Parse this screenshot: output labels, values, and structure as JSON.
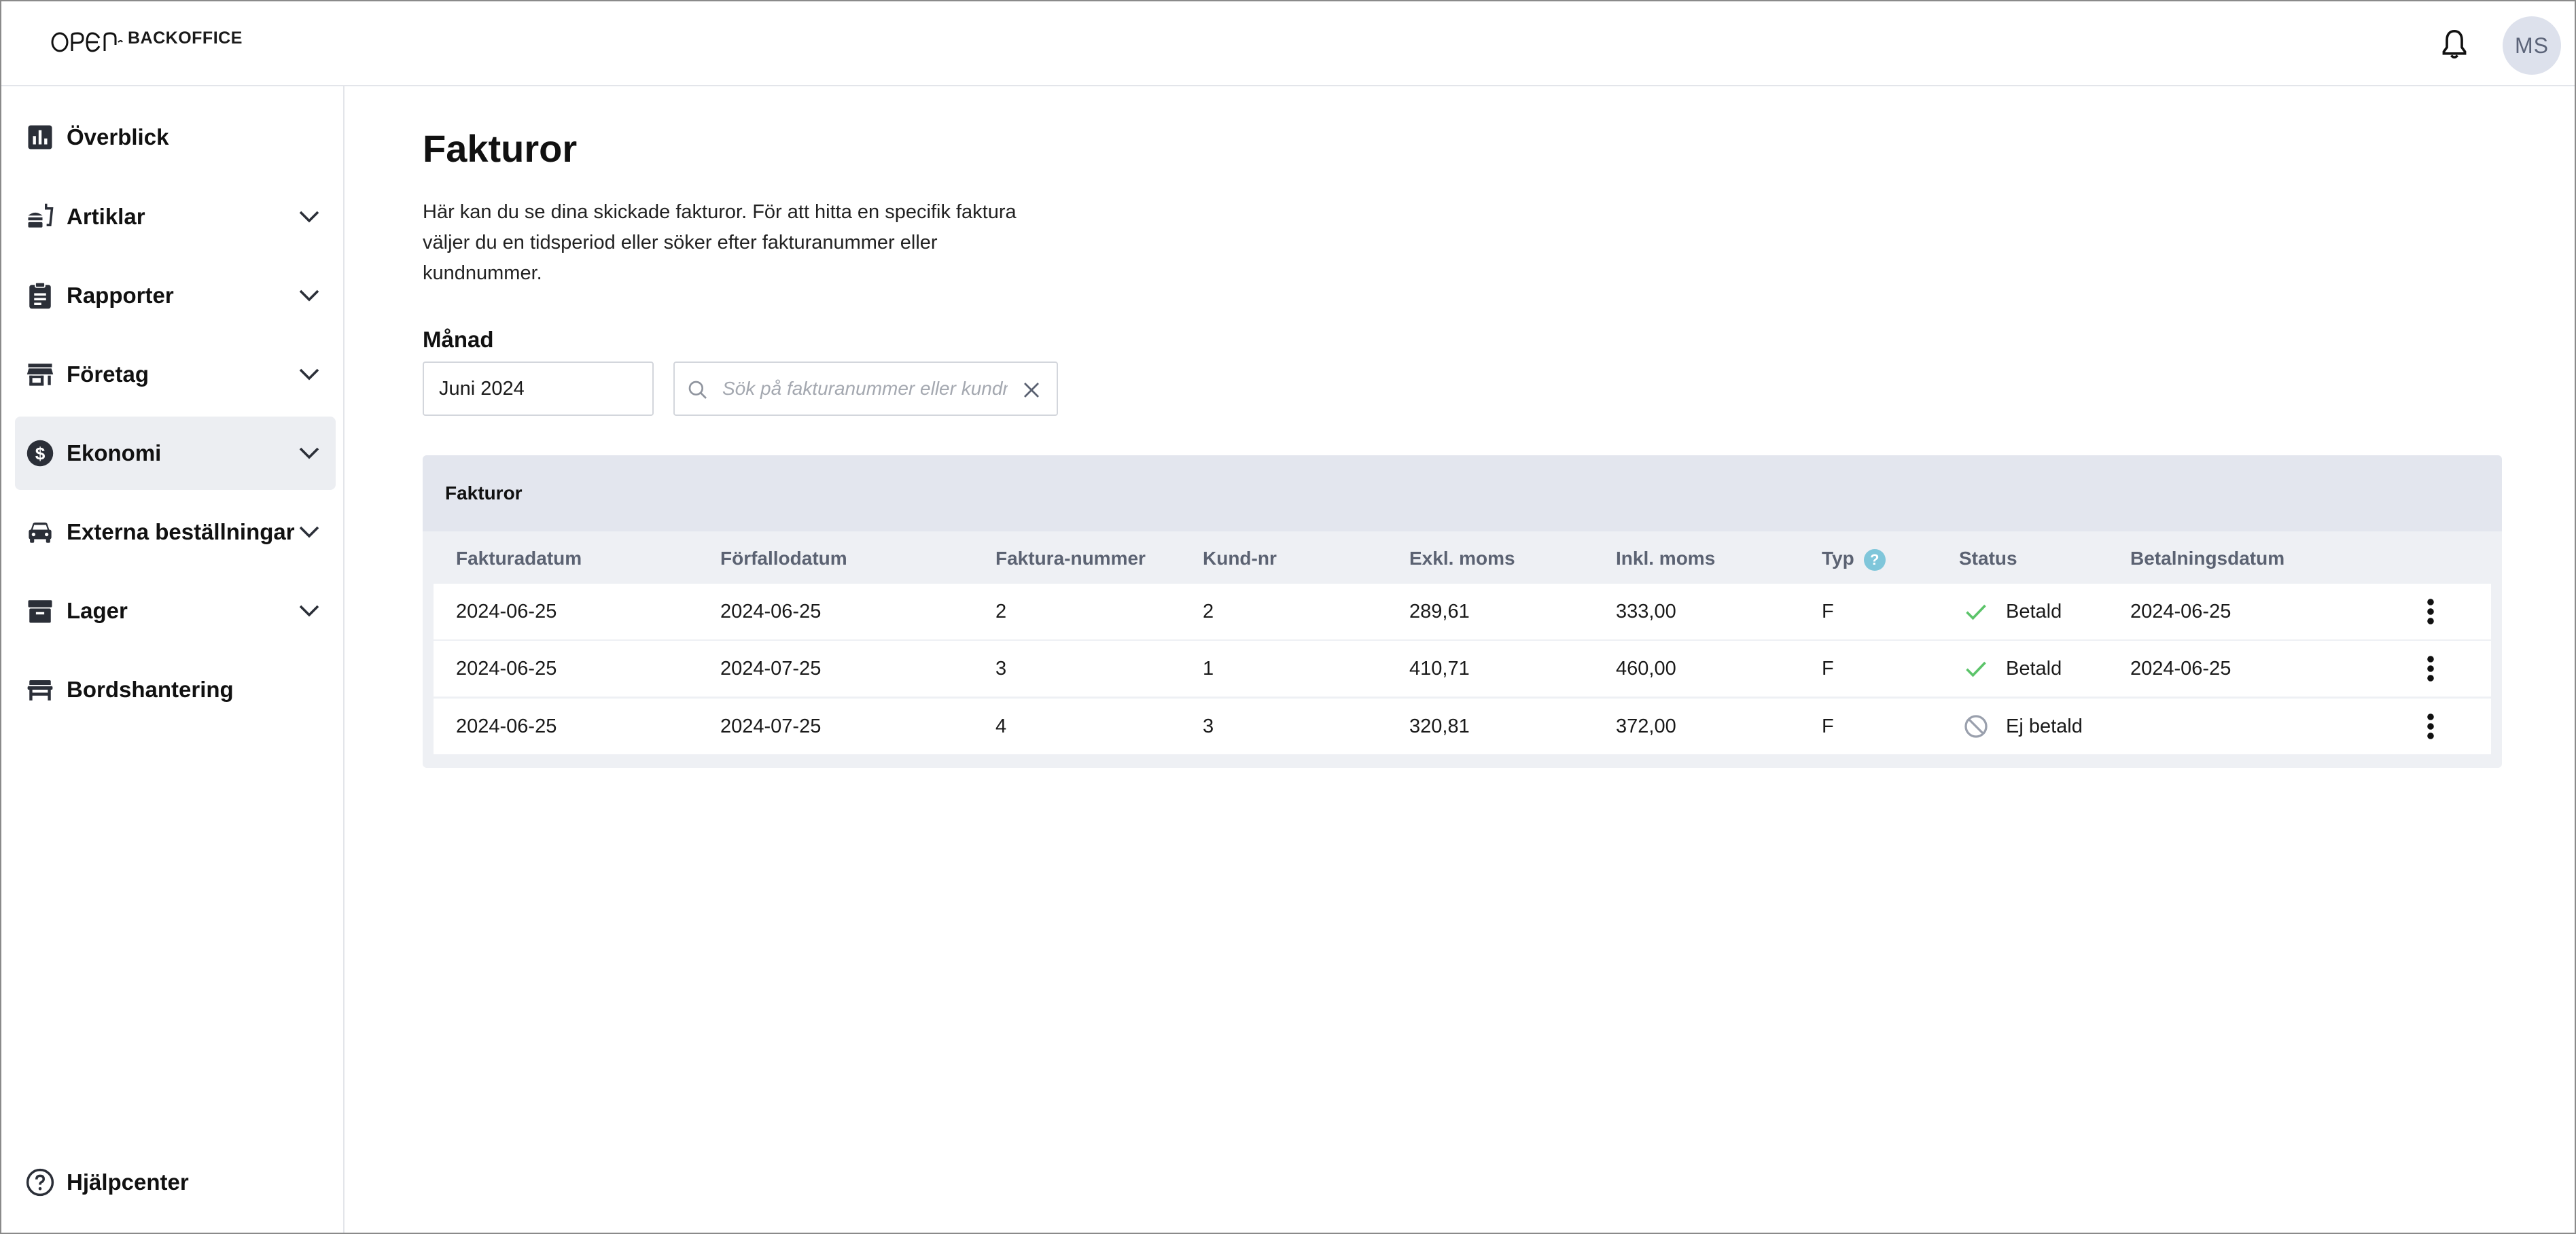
{
  "header": {
    "logo_text": "BACKOFFICE",
    "avatar_initials": "MS"
  },
  "sidebar": {
    "items": [
      {
        "label": "Överblick",
        "icon": "bar-chart-icon",
        "expandable": false
      },
      {
        "label": "Artiklar",
        "icon": "fastfood-icon",
        "expandable": true
      },
      {
        "label": "Rapporter",
        "icon": "clipboard-icon",
        "expandable": true
      },
      {
        "label": "Företag",
        "icon": "storefront-icon",
        "expandable": true
      },
      {
        "label": "Ekonomi",
        "icon": "dollar-icon",
        "expandable": true,
        "active": true
      },
      {
        "label": "Externa beställningar",
        "icon": "car-icon",
        "expandable": true
      },
      {
        "label": "Lager",
        "icon": "archive-icon",
        "expandable": true
      },
      {
        "label": "Bordshantering",
        "icon": "table-icon",
        "expandable": false
      }
    ],
    "help_label": "Hjälpcenter"
  },
  "main": {
    "title": "Fakturor",
    "description": "Här kan du se dina skickade fakturor. För att hitta en specifik faktura väljer du en tidsperiod eller söker efter fakturanummer eller kundnummer.",
    "month_label": "Månad",
    "month_value": "Juni 2024",
    "search_placeholder": "Sök på fakturanummer eller kundnummer"
  },
  "table": {
    "title": "Fakturor",
    "columns": [
      "Fakturadatum",
      "Förfallodatum",
      "Faktura-nummer",
      "Kund-nr",
      "Exkl. moms",
      "Inkl. moms",
      "Typ",
      "Status",
      "Betalningsdatum"
    ],
    "type_help_icon": "?",
    "rows": [
      {
        "invoice_date": "2024-06-25",
        "due_date": "2024-06-25",
        "invoice_no": "2",
        "customer_no": "2",
        "excl_vat": "289,61",
        "incl_vat": "333,00",
        "type": "F",
        "status": "Betald",
        "status_icon": "check-icon",
        "payment_date": "2024-06-25"
      },
      {
        "invoice_date": "2024-06-25",
        "due_date": "2024-07-25",
        "invoice_no": "3",
        "customer_no": "1",
        "excl_vat": "410,71",
        "incl_vat": "460,00",
        "type": "F",
        "status": "Betald",
        "status_icon": "check-icon",
        "payment_date": "2024-06-25"
      },
      {
        "invoice_date": "2024-06-25",
        "due_date": "2024-07-25",
        "invoice_no": "4",
        "customer_no": "3",
        "excl_vat": "320,81",
        "incl_vat": "372,00",
        "type": "F",
        "status": "Ej betald",
        "status_icon": "blocked-icon",
        "payment_date": ""
      }
    ]
  },
  "colors": {
    "success": "#5cc46a",
    "unpaid": "#9aa0ad",
    "active_nav_bg": "#eceef2",
    "table_header_bg": "#e3e6ee",
    "help_icon": "#7fc6da"
  }
}
